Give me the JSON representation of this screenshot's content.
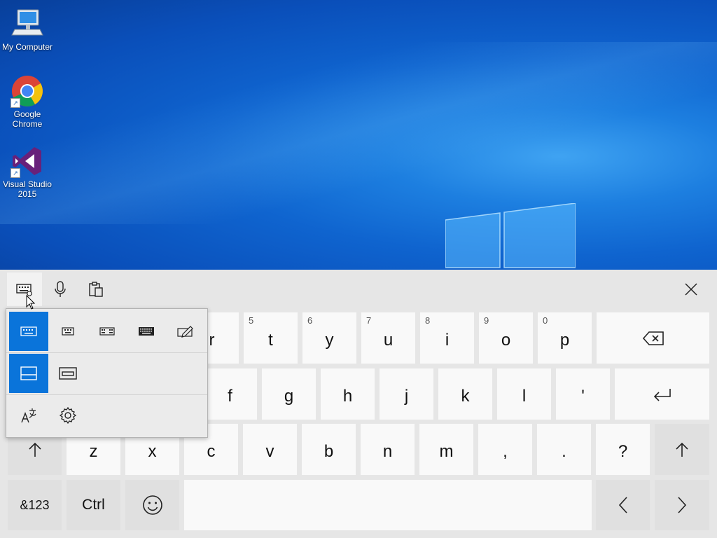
{
  "desktop": {
    "icons": [
      {
        "label": "My Computer",
        "icon": "computer-icon"
      },
      {
        "label": "Google Chrome",
        "icon": "chrome-icon"
      },
      {
        "label": "Visual Studio 2015",
        "icon": "visual-studio-icon"
      }
    ]
  },
  "toolbar": {
    "buttons": [
      {
        "icon": "keyboard-settings-icon",
        "active": true
      },
      {
        "icon": "microphone-icon"
      },
      {
        "icon": "clipboard-icon"
      }
    ],
    "close_icon": "close-icon"
  },
  "keyboard": {
    "row1": [
      {
        "label": "r",
        "num": ""
      },
      {
        "label": "t",
        "num": "5"
      },
      {
        "label": "y",
        "num": "6"
      },
      {
        "label": "u",
        "num": "7"
      },
      {
        "label": "i",
        "num": "8"
      },
      {
        "label": "o",
        "num": "9"
      },
      {
        "label": "p",
        "num": "0"
      }
    ],
    "row2": [
      "f",
      "g",
      "h",
      "j",
      "k",
      "l",
      "'"
    ],
    "row3": [
      "z",
      "x",
      "c",
      "v",
      "b",
      "n",
      "m",
      ",",
      ".",
      "?"
    ],
    "row4": {
      "symbols": "&123",
      "ctrl": "Ctrl"
    },
    "icons": {
      "backspace": "backspace-icon",
      "enter": "enter-icon",
      "shift": "shift-arrow-icon",
      "emoji": "emoji-icon",
      "left": "left-arrow-icon",
      "right": "right-arrow-icon"
    }
  },
  "layout_menu": {
    "selected_layout": "default-keyboard-icon",
    "selected_dock": "docked-icon",
    "layouts": [
      "default-keyboard-icon",
      "small-keyboard-icon",
      "split-keyboard-icon",
      "full-keyboard-icon",
      "handwriting-icon"
    ],
    "docks": [
      "docked-icon",
      "undocked-icon"
    ],
    "extras": [
      "language-icon",
      "settings-gear-icon"
    ]
  },
  "colors": {
    "accent": "#0a74da",
    "key_bg": "#f9f9f9",
    "keyboard_bg": "#e6e6e6"
  }
}
